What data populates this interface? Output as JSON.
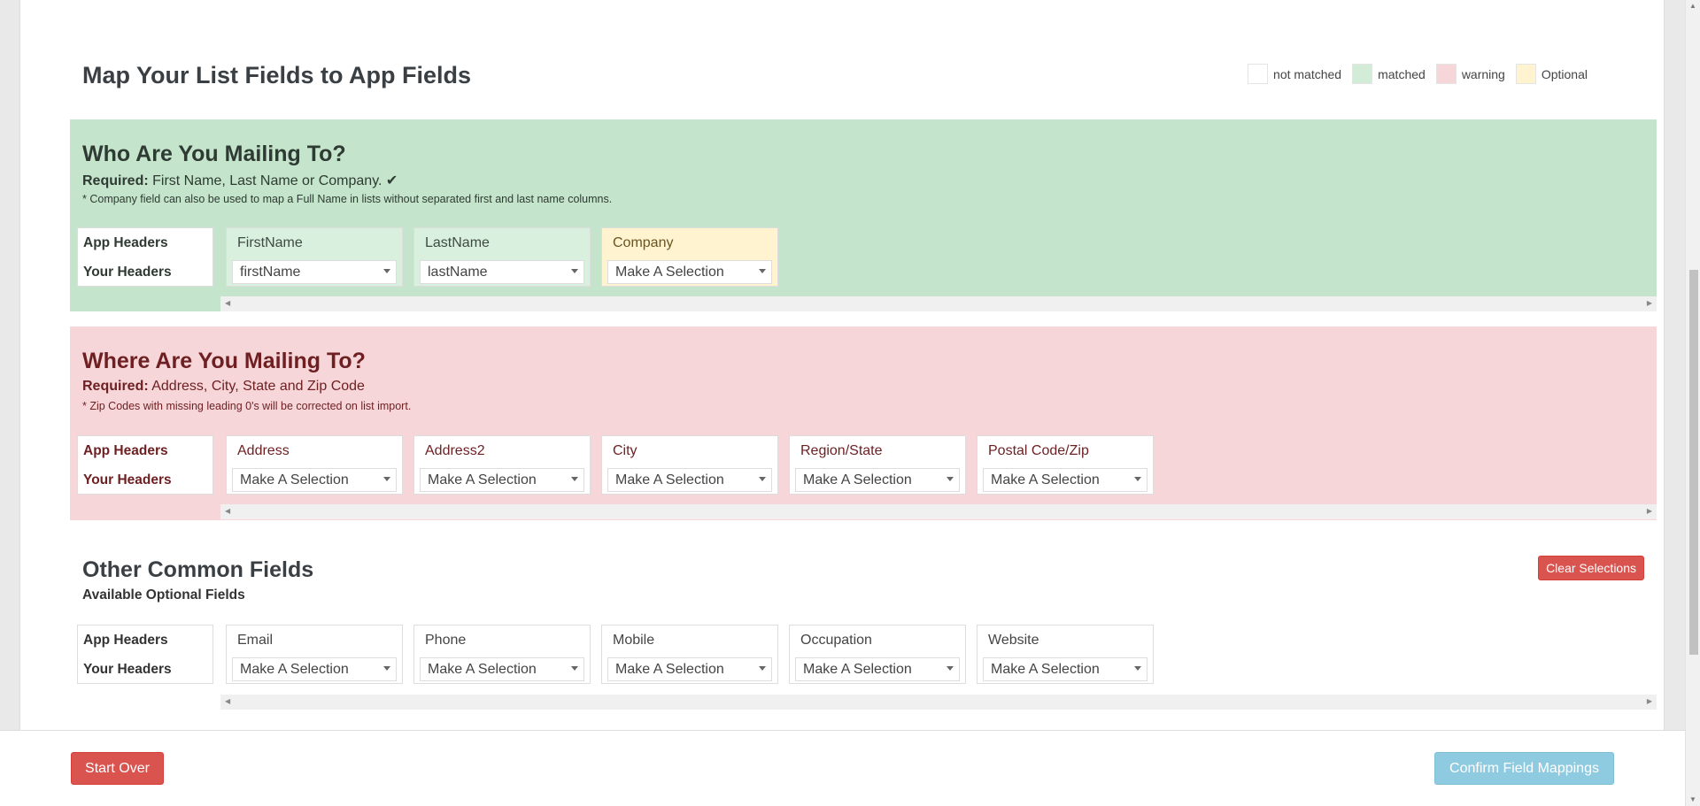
{
  "page_title": "Map Your List Fields to App Fields",
  "legend": [
    {
      "label": "not matched",
      "color": "#ffffff"
    },
    {
      "label": "matched",
      "color": "#d9f0de"
    },
    {
      "label": "warning",
      "color": "#f6d6d9"
    },
    {
      "label": "Optional",
      "color": "#fff3d0"
    }
  ],
  "row_labels": {
    "app": "App Headers",
    "yours": "Your Headers"
  },
  "who": {
    "title": "Who Are You Mailing To?",
    "required_label": "Required:",
    "required_text": " First Name, Last Name or Company. ✔",
    "note": "* Company field can also be used to map a Full Name in lists without separated first and last name columns.",
    "fields": [
      {
        "header": "FirstName",
        "selection": "firstName",
        "state": "matched"
      },
      {
        "header": "LastName",
        "selection": "lastName",
        "state": "matched"
      },
      {
        "header": "Company",
        "selection": "Make A Selection",
        "state": "optional"
      }
    ]
  },
  "where": {
    "title": "Where Are You Mailing To?",
    "required_label": "Required:",
    "required_text": " Address, City, State and Zip Code",
    "note": "* Zip Codes with missing leading 0's will be corrected on list import.",
    "fields": [
      {
        "header": "Address",
        "selection": "Make A Selection"
      },
      {
        "header": "Address2",
        "selection": "Make A Selection"
      },
      {
        "header": "City",
        "selection": "Make A Selection"
      },
      {
        "header": "Region/State",
        "selection": "Make A Selection"
      },
      {
        "header": "Postal Code/Zip",
        "selection": "Make A Selection"
      }
    ]
  },
  "other": {
    "title": "Other Common Fields",
    "subtitle": "Available Optional Fields",
    "clear_label": "Clear Selections",
    "fields": [
      {
        "header": "Email",
        "selection": "Make A Selection"
      },
      {
        "header": "Phone",
        "selection": "Make A Selection"
      },
      {
        "header": "Mobile",
        "selection": "Make A Selection"
      },
      {
        "header": "Occupation",
        "selection": "Make A Selection"
      },
      {
        "header": "Website",
        "selection": "Make A Selection"
      }
    ]
  },
  "footer": {
    "start_over": "Start Over",
    "confirm": "Confirm Field Mappings"
  }
}
